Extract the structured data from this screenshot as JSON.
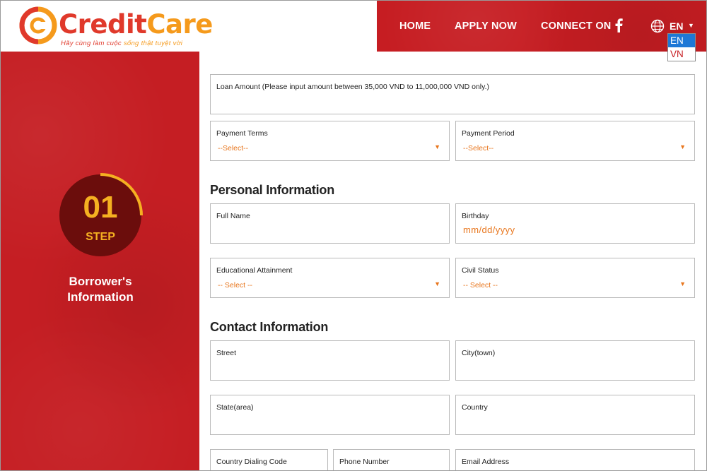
{
  "brand": {
    "name_part1": "Credit",
    "name_part2": "Care",
    "tagline_part1": "Hãy cùng làm cuộc",
    "tagline_part2": "sống thật tuyệt vời",
    "primary_color": "#c61d22",
    "accent_color": "#f59a1c"
  },
  "nav": {
    "home": "HOME",
    "apply_now": "APPLY NOW",
    "connect_on": "CONNECT ON",
    "facebook_icon": "facebook-icon",
    "globe_icon": "globe-icon",
    "language_current": "EN",
    "language_caret": "▼",
    "language_options": [
      "EN",
      "VN"
    ]
  },
  "step": {
    "number": "01",
    "label": "STEP",
    "title": "Borrower's Information"
  },
  "loan": {
    "amount_label": "Loan Amount (Please input amount between 35,000 VND to 11,000,000 VND only.)",
    "payment_terms_label": "Payment Terms",
    "payment_terms_value": "--Select--",
    "payment_period_label": "Payment Period",
    "payment_period_value": "--Select--"
  },
  "personal": {
    "section_title": "Personal Information",
    "full_name_label": "Full Name",
    "birthday_label": "Birthday",
    "birthday_placeholder": "mm/dd/yyyy",
    "education_label": "Educational Attainment",
    "education_value": "-- Select --",
    "civil_status_label": "Civil Status",
    "civil_status_value": "-- Select --"
  },
  "contact": {
    "section_title": "Contact Information",
    "street_label": "Street",
    "city_label": "City(town)",
    "state_label": "State(area)",
    "country_label": "Country",
    "dialing_code_label": "Country Dialing Code",
    "phone_label": "Phone Number",
    "email_label": "Email Address"
  },
  "select_caret": "▼"
}
